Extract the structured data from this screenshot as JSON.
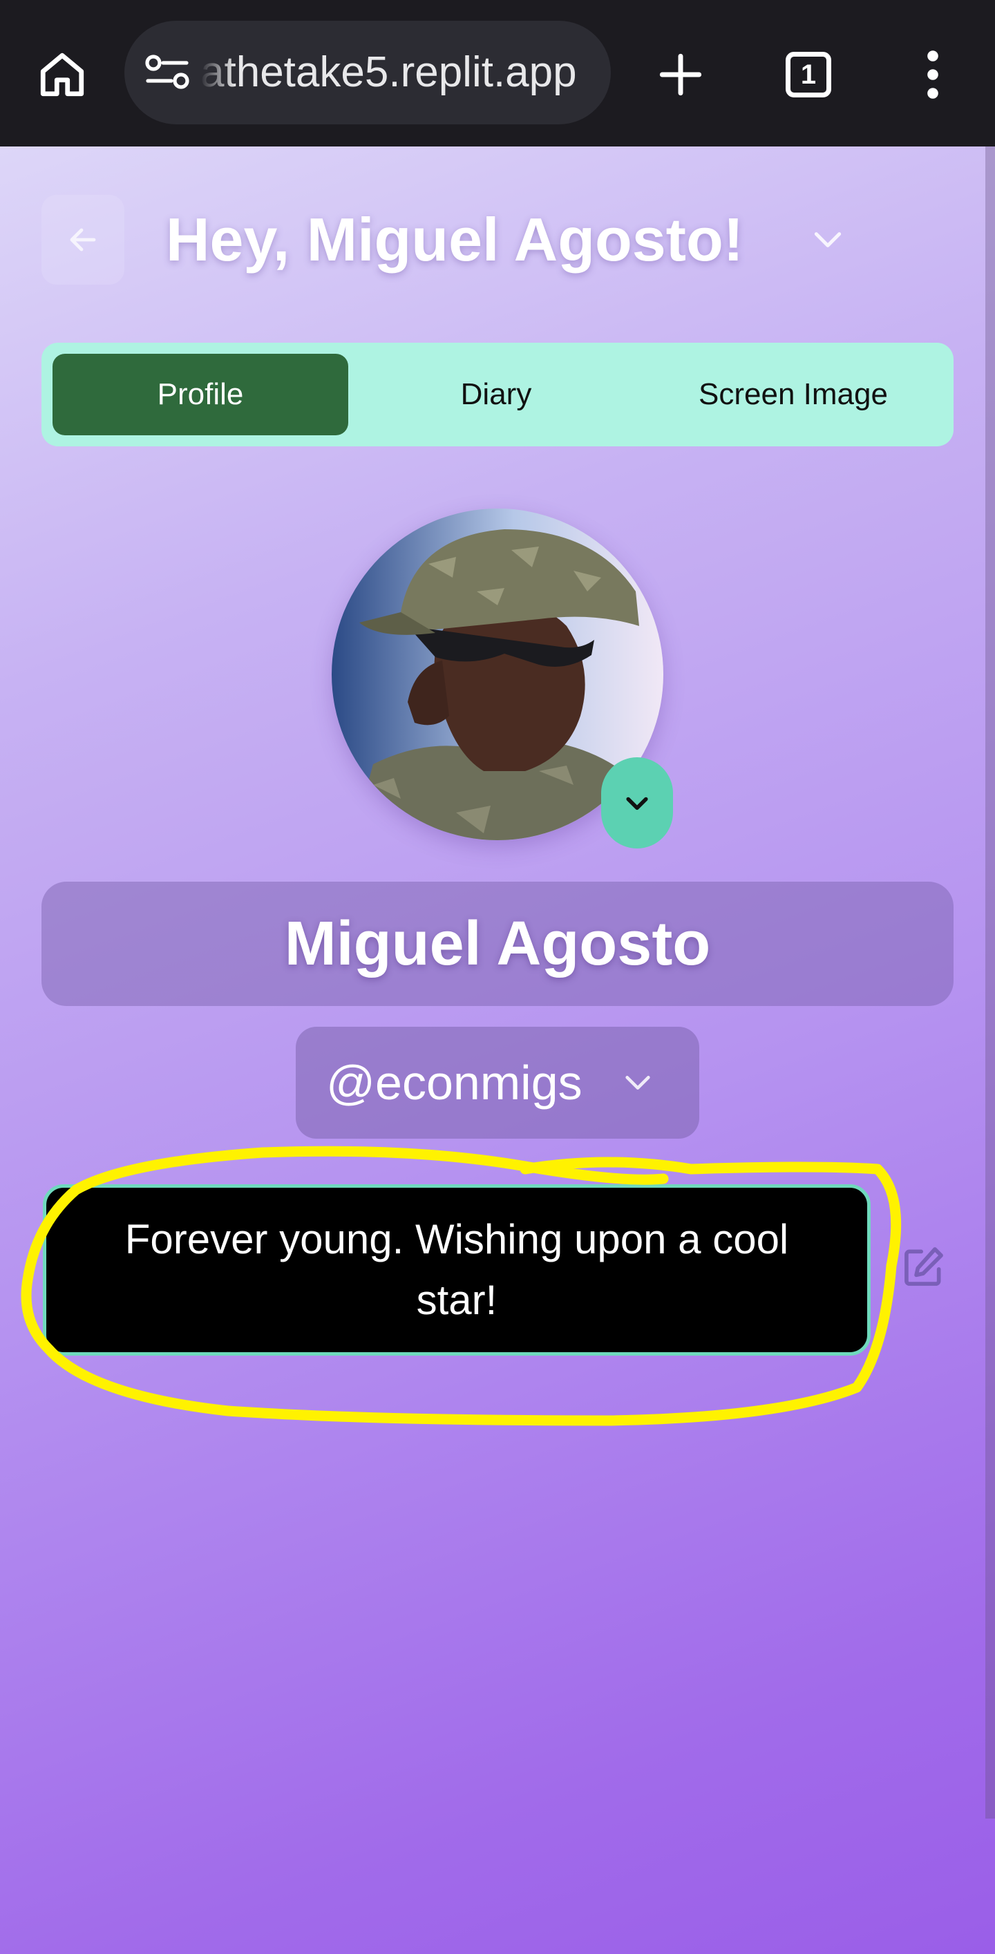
{
  "browser": {
    "url": "athetake5.replit.app",
    "tab_count": "1"
  },
  "header": {
    "greeting": "Hey, Miguel Agosto!"
  },
  "tabs": [
    {
      "label": "Profile",
      "active": true
    },
    {
      "label": "Diary",
      "active": false
    },
    {
      "label": "Screen Image",
      "active": false
    }
  ],
  "profile": {
    "display_name": "Miguel Agosto",
    "handle": "@econmigs",
    "bio": "Forever young. Wishing upon a cool star!"
  },
  "colors": {
    "tab_bar": "#aef3e2",
    "active_tab": "#2f6a3c",
    "accent_teal": "#5cd1b2",
    "bio_border": "#6fd9bd",
    "highlight_scribble": "#fff200"
  },
  "icons": {
    "home": "home-icon",
    "site_info": "site-info-icon",
    "new_tab": "plus-icon",
    "menu": "kebab-menu-icon",
    "back": "arrow-left-icon",
    "chevron": "chevron-down-icon",
    "edit": "edit-icon"
  }
}
